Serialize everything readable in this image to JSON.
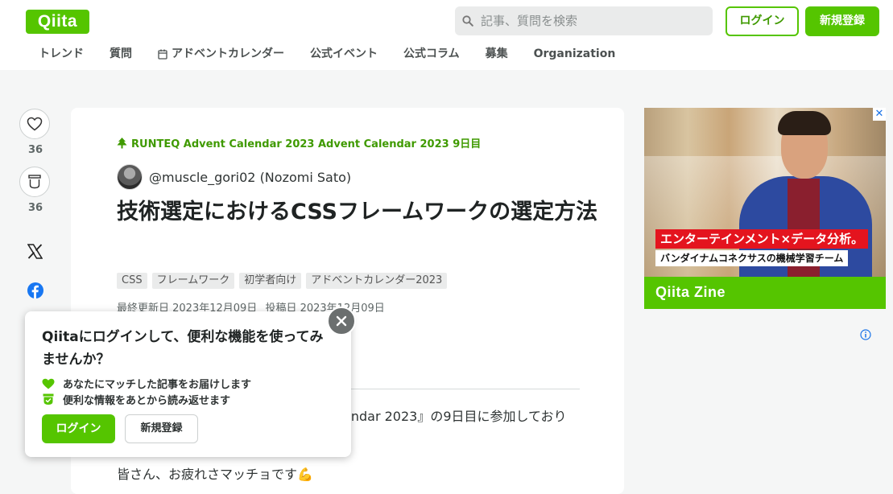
{
  "header": {
    "logo": "Qiita",
    "search_placeholder": "記事、質問を検索",
    "login_label": "ログイン",
    "signup_label": "新規登録",
    "nav": [
      "トレンド",
      "質問",
      "アドベントカレンダー",
      "公式イベント",
      "公式コラム",
      "募集",
      "Organization"
    ]
  },
  "side": {
    "like_count": "36",
    "stock_count": "36"
  },
  "article": {
    "advent_calendar": "RUNTEQ Advent Calendar 2023 Advent Calendar 2023 9日目",
    "author": "@muscle_gori02 (Nozomi Sato)",
    "title": "技術選定におけるCSSフレームワークの選定方法",
    "tags": [
      "CSS",
      "フレームワーク",
      "初学者向け",
      "アドベントカレンダー2023"
    ],
    "updated": "最終更新日 2023年12月09日",
    "posted": "投稿日 2023年12月09日",
    "body_line1": "endar 2023』の9日目に参加しており",
    "body_line2": "皆さん、お疲れさマッチョです💪"
  },
  "ad": {
    "headline": "エンターテインメント×データ分析。",
    "subline": "バンダイナムコネクサスの機械学習チーム",
    "brand": "Qiita Zine",
    "close": "✕",
    "colors": {
      "brand": "#55c500",
      "headline_bg": "#e4141e"
    }
  },
  "popup": {
    "title": "Qiitaにログインして、便利な機能を使ってみませんか？",
    "benefit1": "あなたにマッチした記事をお届けします",
    "benefit2": "便利な情報をあとから読み返せます",
    "login_label": "ログイン",
    "signup_label": "新規登録"
  },
  "colors": {
    "accent": "#55c500",
    "background": "#f5f6f6"
  }
}
